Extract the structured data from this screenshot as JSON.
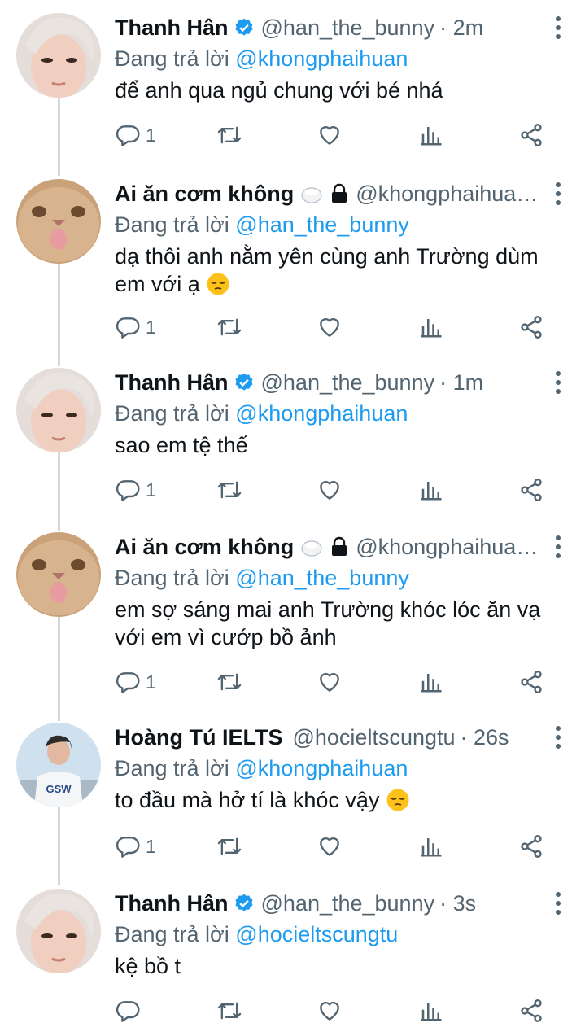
{
  "reply_prefix": "Đang trả lời",
  "tweets": [
    {
      "name": "Thanh Hân",
      "handle": "@han_the_bunny",
      "time": "· 2m",
      "replying_to": "@khongphaihuan",
      "text": "để anh qua ngủ chung với bé nhá",
      "reply_count": "1",
      "verified": true,
      "avatar": "boy-face"
    },
    {
      "name": "Ai ăn cơm không",
      "handle": "@khongphaihua…",
      "time": "",
      "replying_to": "@han_the_bunny",
      "text": "dạ thôi anh nằm yên cùng anh Trường dùm em với ạ",
      "text_emoji": "pensive-face-emoji",
      "reply_count": "1",
      "verified": false,
      "avatar": "cat-face"
    },
    {
      "name": "Thanh Hân",
      "handle": "@han_the_bunny",
      "time": "· 1m",
      "replying_to": "@khongphaihuan",
      "text": "sao em tệ thế",
      "reply_count": "1",
      "verified": true,
      "avatar": "boy-face"
    },
    {
      "name": "Ai ăn cơm không",
      "handle": "@khongphaihua…",
      "time": "",
      "replying_to": "@han_the_bunny",
      "text": "em sợ sáng mai anh Trường khóc lóc ăn vạ với em vì cướp bồ ảnh",
      "reply_count": "1",
      "verified": false,
      "avatar": "cat-face"
    },
    {
      "name": "Hoàng Tú IELTS",
      "handle": "@hocieltscungtu",
      "time": "· 26s",
      "replying_to": "@khongphaihuan",
      "text": "to đầu mà hở tí là khóc vậy",
      "text_emoji": "pensive-face-emoji",
      "reply_count": "1",
      "verified": false,
      "avatar": "photo-gsw-shirt"
    },
    {
      "name": "Thanh Hân",
      "handle": "@han_the_bunny",
      "time": "· 3s",
      "replying_to": "@hocieltscungtu",
      "text": "kệ bồ t",
      "reply_count": "",
      "verified": true,
      "avatar": "boy-face"
    }
  ],
  "avatar_texts": {
    "shirt_text": "GSW"
  },
  "colors": {
    "link": "#1d9bf0",
    "muted": "#536471",
    "thread_line": "#cfd9de"
  }
}
